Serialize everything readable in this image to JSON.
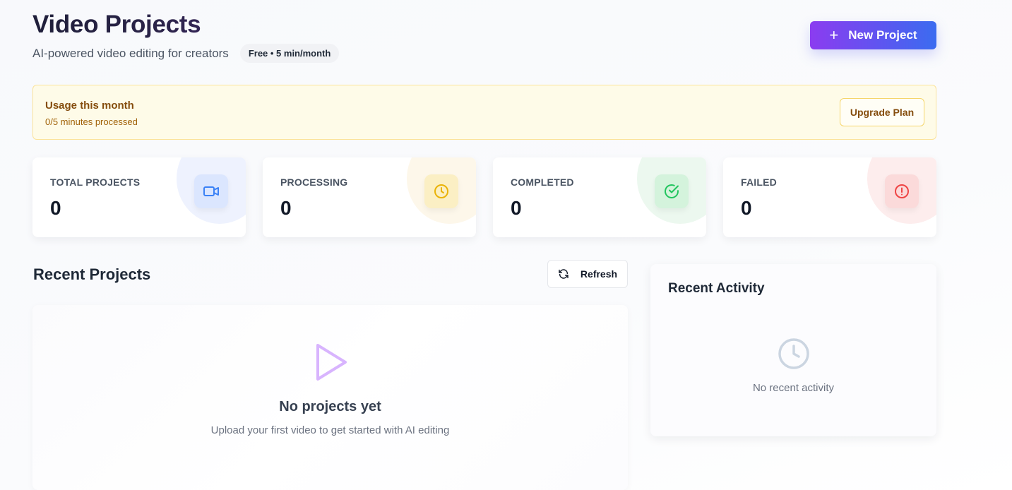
{
  "header": {
    "title": "Video Projects",
    "subtitle": "AI-powered video editing for creators",
    "plan_badge": "Free • 5 min/month",
    "new_project_label": "New Project",
    "new_project_icon": "plus-icon"
  },
  "usage": {
    "title": "Usage this month",
    "detail": "0/5 minutes processed",
    "upgrade_label": "Upgrade Plan"
  },
  "stats": [
    {
      "label": "TOTAL PROJECTS",
      "value": "0",
      "icon": "video-camera-icon",
      "color": "#3b82f6",
      "tint": "#dbe6fe"
    },
    {
      "label": "PROCESSING",
      "value": "0",
      "icon": "clock-icon",
      "color": "#eab308",
      "tint": "#fbefc4"
    },
    {
      "label": "COMPLETED",
      "value": "0",
      "icon": "check-circle-icon",
      "color": "#22c55e",
      "tint": "#d4f3dc"
    },
    {
      "label": "FAILED",
      "value": "0",
      "icon": "alert-circle-icon",
      "color": "#ef4444",
      "tint": "#fbdada"
    }
  ],
  "recent_projects": {
    "title": "Recent Projects",
    "refresh_label": "Refresh",
    "empty_title": "No projects yet",
    "empty_subtitle": "Upload your first video to get started with AI editing",
    "empty_icon": "play-icon"
  },
  "recent_activity": {
    "title": "Recent Activity",
    "empty_text": "No recent activity",
    "empty_icon": "clock-icon"
  }
}
